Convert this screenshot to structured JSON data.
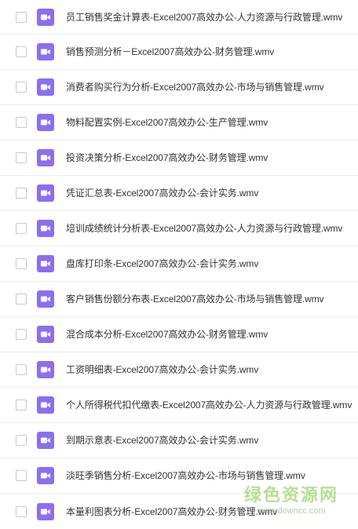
{
  "files": [
    {
      "name": "员工销售奖金计算表-Excel2007高效办公-人力资源与行政管理.wmv",
      "icon": "video-file-icon"
    },
    {
      "name": "销售预测分析－Excel2007高效办公-财务管理.wmv",
      "icon": "video-file-icon"
    },
    {
      "name": "消费者购买行为分析-Excel2007高效办公-市场与销售管理.wmv",
      "icon": "video-file-icon"
    },
    {
      "name": "物料配置实例-Excel2007高效办公-生产管理.wmv",
      "icon": "video-file-icon"
    },
    {
      "name": "投资决策分析-Excel2007高效办公-财务管理.wmv",
      "icon": "video-file-icon"
    },
    {
      "name": "凭证汇总表-Excel2007高效办公-会计实务.wmv",
      "icon": "video-file-icon"
    },
    {
      "name": "培训成绩统计分析表-Excel2007高效办公-人力资源与行政管理.wmv",
      "icon": "video-file-icon"
    },
    {
      "name": "盘库打印条-Excel2007高效办公-会计实务.wmv",
      "icon": "video-file-icon"
    },
    {
      "name": "客户销售份额分布表-Excel2007高效办公-市场与销售管理.wmv",
      "icon": "video-file-icon"
    },
    {
      "name": "混合成本分析-Excel2007高效办公-财务管理.wmv",
      "icon": "video-file-icon"
    },
    {
      "name": "工资明细表-Excel2007高效办公-会计实务.wmv",
      "icon": "video-file-icon"
    },
    {
      "name": "个人所得税代扣代缴表-Excel2007高效办公-人力资源与行政管理.wmv",
      "icon": "video-file-icon"
    },
    {
      "name": "到期示意表-Excel2007高效办公-会计实务.wmv",
      "icon": "video-file-icon"
    },
    {
      "name": "淡旺季销售分析-Excel2007高效办公-市场与销售管理.wmv",
      "icon": "video-file-icon"
    },
    {
      "name": "本量利图表分析-Excel2007高效办公-财务管理.wmv",
      "icon": "video-file-icon"
    }
  ],
  "watermark": {
    "title": "绿色资源网",
    "url": "www.downcc.com"
  },
  "colors": {
    "icon_purple": "#8c6ef0",
    "text": "#333333",
    "divider": "#ececec",
    "checkbox_border": "#c9c9c9"
  }
}
